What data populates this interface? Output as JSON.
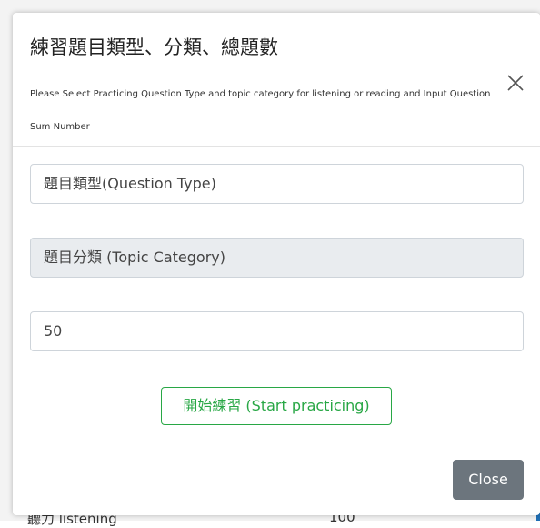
{
  "modal": {
    "title": "練習題目類型、分類、總題數",
    "subtitle": "Please Select Practicing Question Type and topic category for listening or reading and Input Question Sum Number",
    "close_icon": "close-icon"
  },
  "form": {
    "question_type_placeholder": "題目類型(Question Type)",
    "topic_category_placeholder": "題目分類 (Topic Category)",
    "question_sum_value": "50",
    "start_button_label": "開始練習 (Start practicing)"
  },
  "footer": {
    "close_button_label": "Close"
  },
  "background": {
    "partial_text_left": "聽力 listening",
    "partial_text_right": "100"
  },
  "colors": {
    "start_button_accent": "#28a745",
    "close_button_bg": "#6c757d",
    "disabled_field_bg": "#e9ecef"
  }
}
